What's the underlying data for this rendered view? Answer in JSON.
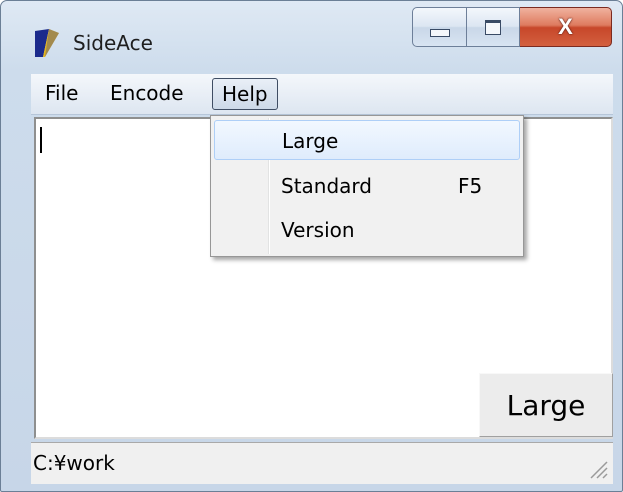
{
  "window": {
    "title": "SideAce",
    "close_glyph": "X",
    "icons": {
      "app": "sideace-app-icon",
      "minimize": "minimize-icon",
      "maximize": "maximize-icon",
      "close": "close-icon",
      "grip": "resize-grip-icon"
    }
  },
  "menubar": {
    "items": [
      {
        "label": "File"
      },
      {
        "label": "Encode"
      },
      {
        "label": "Help"
      }
    ]
  },
  "help_menu": {
    "items": [
      {
        "label": "Large",
        "shortcut": ""
      },
      {
        "label": "Standard",
        "shortcut": "F5"
      },
      {
        "label": "Version",
        "shortcut": ""
      }
    ]
  },
  "editor": {
    "text": ""
  },
  "large_button": {
    "label": "Large"
  },
  "status": {
    "path": "C:¥work"
  },
  "colors": {
    "accent_highlight": "#dfecfc",
    "close_button": "#c7472a",
    "titlebar": "#dfe9f4"
  }
}
